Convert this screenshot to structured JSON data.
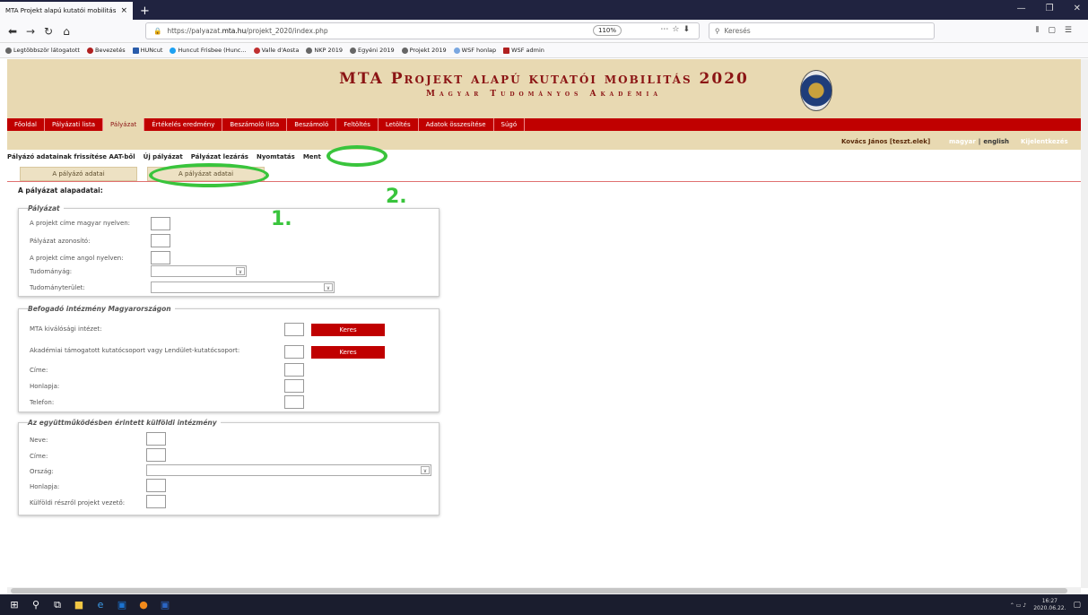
{
  "browser": {
    "tab_title": "MTA Projekt alapú kutatói mobilitás",
    "tab_close": "×",
    "new_tab": "+",
    "url_prefix": "https://palyazat.",
    "url_domain": "mta.hu",
    "url_path": "/projekt_2020/index.php",
    "zoom": "110%",
    "search_placeholder": "Keresés",
    "bookmarks": [
      "Legtöbbször látogatott",
      "Bevezetés",
      "HUNcut",
      "Huncut Frisbee (Hunc...",
      "Valle d'Aosta",
      "NKP 2019",
      "Egyéni 2019",
      "Projekt 2019",
      "WSF honlap",
      "WSF admin"
    ]
  },
  "header": {
    "title": "MTA Projekt alapú kutatói mobilitás 2020",
    "subtitle": "Magyar Tudományos Akadémia"
  },
  "menu": [
    "Főoldal",
    "Pályázati lista",
    "Pályázat",
    "Értékelés eredmény",
    "Beszámoló lista",
    "Beszámoló",
    "Feltöltés",
    "Letöltés",
    "Adatok összesítése",
    "Súgó"
  ],
  "userbar": {
    "user": "Kovács János [teszt.elek]",
    "lang_hu": "magyar",
    "lang_sep": "|",
    "lang_en": "english",
    "logout": "Kijelentkezés"
  },
  "actions": [
    "Pályázó adatainak frissítése AAT-ből",
    "Új pályázat",
    "Pályázat lezárás",
    "Nyomtatás",
    "Ment"
  ],
  "subtabs": [
    "A pályázó adatai",
    "A pályázat adatai"
  ],
  "page_label": "A pályázat alapadatai:",
  "annotations": [
    "1.",
    "2."
  ],
  "sections": {
    "palyazat": {
      "legend": "Pályázat",
      "fields": [
        "A projekt címe magyar nyelven:",
        "Pályázat azonosító:",
        "A projekt címe angol nyelven:",
        "Tudományág:",
        "Tudományterület:"
      ]
    },
    "befogado": {
      "legend": "Befogadó intézmény Magyarországon",
      "fields": [
        "MTA kiválósági intézet:",
        "Akadémiai támogatott kutatócsoport vagy Lendület-kutatócsoport:",
        "Címe:",
        "Honlapja:",
        "Telefon:"
      ],
      "button": "Keres"
    },
    "kulfoldi": {
      "legend": "Az együttműködésben érintett külföldi intézmény",
      "fields": [
        "Neve:",
        "Címe:",
        "Ország:",
        "Honlapja:",
        "Külföldi részről projekt vezető:"
      ]
    }
  },
  "taskbar": {
    "time": "16:27",
    "date": "2020.06.22."
  }
}
